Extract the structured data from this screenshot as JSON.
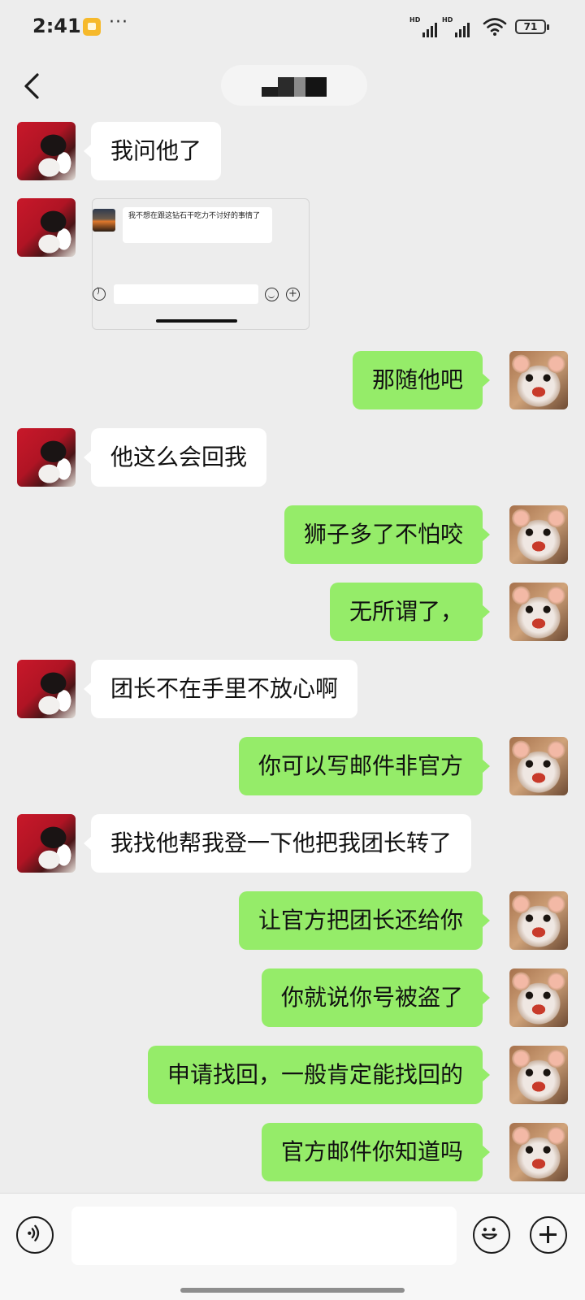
{
  "status_bar": {
    "time": "2:41",
    "battery": "71",
    "signal_label_1": "HD",
    "signal_label_2": "HD"
  },
  "header": {
    "title": ""
  },
  "image_message": {
    "text": "我不想在跟这钻石干吃力不讨好的事情了"
  },
  "messages": [
    {
      "side": "left",
      "text": "我问他了"
    },
    {
      "side": "left",
      "type": "image"
    },
    {
      "side": "right",
      "text": "那随他吧"
    },
    {
      "side": "left",
      "text": "他这么会回我"
    },
    {
      "side": "right",
      "text": "狮子多了不怕咬"
    },
    {
      "side": "right",
      "text": "无所谓了，"
    },
    {
      "side": "left",
      "text": "团长不在手里不放心啊"
    },
    {
      "side": "right",
      "text": "你可以写邮件非官方"
    },
    {
      "side": "left",
      "text": "我找他帮我登一下他把我团长转了"
    },
    {
      "side": "right",
      "text": "让官方把团长还给你"
    },
    {
      "side": "right",
      "text": "你就说你号被盗了"
    },
    {
      "side": "right",
      "text": "申请找回，一般肯定能找回的"
    },
    {
      "side": "right",
      "text": "官方邮件你知道吗"
    }
  ],
  "input_bar": {
    "placeholder": ""
  },
  "colors": {
    "background": "#ededed",
    "sent_bubble": "#95ec69",
    "received_bubble": "#ffffff"
  },
  "icons": {
    "back": "back-arrow-icon",
    "voice": "voice-icon",
    "emoji": "emoji-icon",
    "plus": "plus-icon"
  }
}
